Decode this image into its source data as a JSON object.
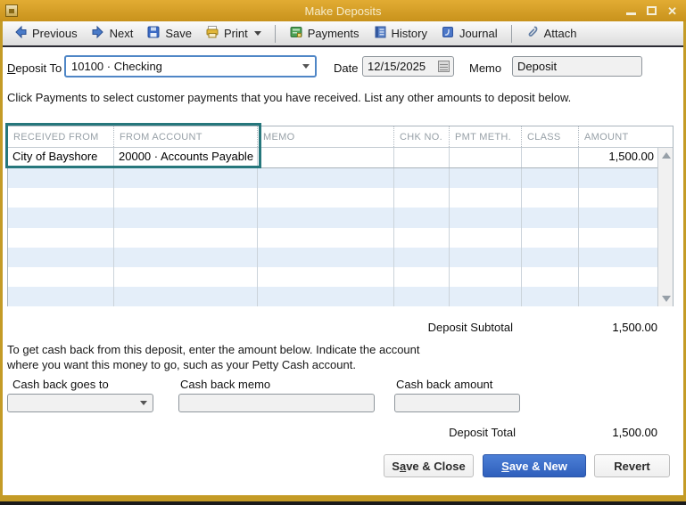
{
  "colors": {
    "titlebar_gold": "#D9A62E",
    "highlight_teal": "#26777C",
    "primary_button_blue": "#3565C0",
    "row_alt_blue": "#E4EEF9",
    "focus_border_blue": "#4F86C6"
  },
  "window": {
    "title": "Make Deposits",
    "controls": {
      "close": "✕"
    }
  },
  "toolbar": {
    "previous": "Previous",
    "next": "Next",
    "save": "Save",
    "print": "Print",
    "payments": "Payments",
    "history": "History",
    "journal": "Journal",
    "attach": "Attach"
  },
  "form": {
    "deposit_to": {
      "u": "D",
      "post": "eposit To"
    },
    "deposit_to_value": "10100 · Checking",
    "date_label": "Date",
    "date_value": "12/15/2025",
    "memo_label": "Memo",
    "memo_value": "Deposit"
  },
  "instruction": "Click Payments to select customer payments that you have received. List any other amounts to deposit below.",
  "table": {
    "columns": [
      "RECEIVED FROM",
      "FROM ACCOUNT",
      "MEMO",
      "CHK NO.",
      "PMT METH.",
      "CLASS",
      "AMOUNT"
    ],
    "rows": [
      {
        "received_from": "City of Bayshore",
        "from_account": "20000 · Accounts Payable",
        "memo": "",
        "chk_no": "",
        "pmt_meth": "",
        "class": "",
        "amount": "1,500.00"
      }
    ]
  },
  "subtotal": {
    "label": "Deposit Subtotal",
    "value": "1,500.00"
  },
  "cashback": {
    "description_line1": "To get cash back from this deposit, enter the amount below.  Indicate the account",
    "description_line2": "where you want this money to go, such as your Petty Cash account.",
    "goes_to_label": "Cash back goes to",
    "memo_label": "Cash back memo",
    "amount_label": "Cash back amount",
    "goes_to_value": "",
    "memo_value": "",
    "amount_value": ""
  },
  "total": {
    "label": "Deposit Total",
    "value": "1,500.00"
  },
  "buttons": {
    "save_close": {
      "pre": "S",
      "u": "a",
      "post": "ve & Close"
    },
    "save_new": {
      "u": "S",
      "post": "ave & New"
    },
    "revert": "Revert"
  }
}
